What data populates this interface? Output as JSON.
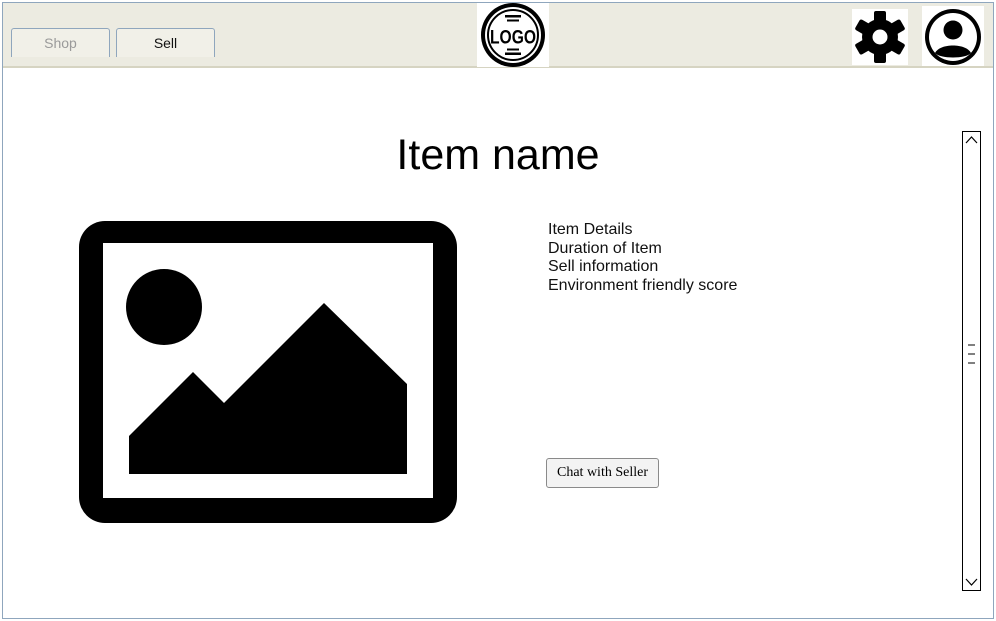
{
  "tabs": [
    {
      "label": "Shop",
      "active": false
    },
    {
      "label": "Sell",
      "active": true
    }
  ],
  "header": {
    "logo_text": "LOGO",
    "icons": [
      "settings-gear-icon",
      "user-avatar-icon"
    ]
  },
  "item": {
    "title": "Item name",
    "image_icon": "image-placeholder-icon",
    "details": [
      "Item Details",
      "Duration of Item",
      "Sell information",
      "Environment friendly score"
    ],
    "chat_button_label": "Chat with Seller"
  },
  "colors": {
    "header_bg": "#ecebe1",
    "tab_border": "#8fa6bd",
    "inactive_tab_text": "#9a9a9a"
  }
}
